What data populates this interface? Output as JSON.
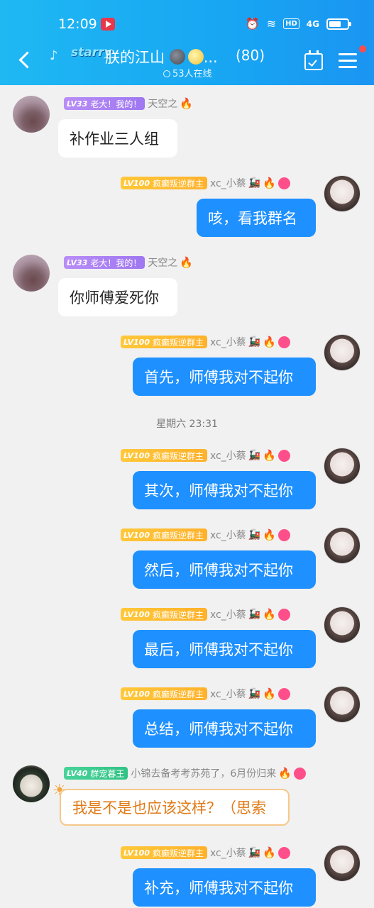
{
  "status_bar": {
    "time": "12:09",
    "network": "4G",
    "hd": "HD"
  },
  "header": {
    "group_prefix": "starry",
    "title": "朕的江山",
    "title_suffix": "...",
    "member_count": "(80)",
    "online": "53人在线"
  },
  "messages": [
    {
      "side": "left",
      "level": "LV33",
      "badge": "老大！我的！",
      "badge_color": "#a981f3",
      "nickname": "天空之",
      "text": "补作业三人组"
    },
    {
      "side": "right",
      "level": "LV100",
      "badge": "疯癫叛逆群主",
      "badge_color": "#ffbd33",
      "nickname": "xc_小蔡",
      "text": "咳，看我群名"
    },
    {
      "side": "left",
      "level": "LV33",
      "badge": "老大！我的！",
      "badge_color": "#a981f3",
      "nickname": "天空之",
      "text": "你师傅爱死你"
    },
    {
      "side": "right",
      "level": "LV100",
      "badge": "疯癫叛逆群主",
      "badge_color": "#ffbd33",
      "nickname": "xc_小蔡",
      "text": "首先，师傅我对不起你"
    },
    {
      "side": "right",
      "level": "LV100",
      "badge": "疯癫叛逆群主",
      "badge_color": "#ffbd33",
      "nickname": "xc_小蔡",
      "text": "其次，师傅我对不起你"
    },
    {
      "side": "right",
      "level": "LV100",
      "badge": "疯癫叛逆群主",
      "badge_color": "#ffbd33",
      "nickname": "xc_小蔡",
      "text": "然后，师傅我对不起你"
    },
    {
      "side": "right",
      "level": "LV100",
      "badge": "疯癫叛逆群主",
      "badge_color": "#ffbd33",
      "nickname": "xc_小蔡",
      "text": "最后，师傅我对不起你"
    },
    {
      "side": "right",
      "level": "LV100",
      "badge": "疯癫叛逆群主",
      "badge_color": "#ffbd33",
      "nickname": "xc_小蔡",
      "text": "总结，师傅我对不起你"
    },
    {
      "side": "left",
      "level": "LV40",
      "badge": "群宠暮王",
      "badge_color": "#3ccb8e",
      "nickname": "小锦去备考考苏苑了，6月份归来",
      "text": "我是不是也应该这样？（思索"
    },
    {
      "side": "right",
      "level": "LV100",
      "badge": "疯癫叛逆群主",
      "badge_color": "#ffbd33",
      "nickname": "xc_小蔡",
      "text": "补充，师傅我对不起你"
    }
  ],
  "timestamp": "星期六 23:31",
  "colors": {
    "header": "#1aa6f3",
    "bubble_self": "#1e90ff",
    "bubble_other": "#ffffff",
    "background": "#f1f1f1"
  }
}
